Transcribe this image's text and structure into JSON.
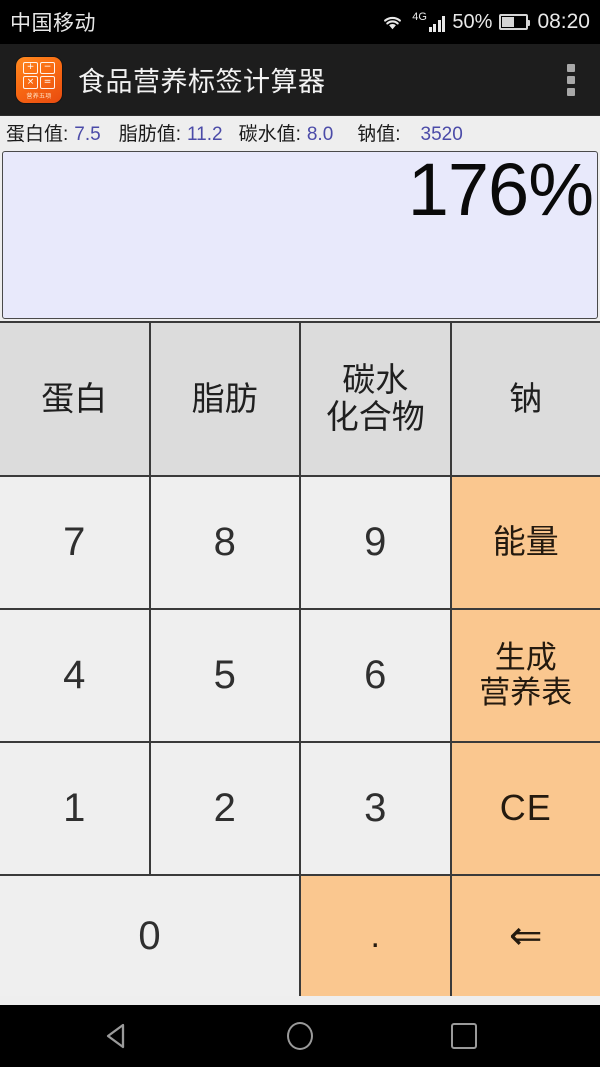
{
  "status_bar": {
    "carrier": "中国移动",
    "wifi_icon": "wifi-icon",
    "network_label": "4G",
    "signal_icon": "signal-bars-icon",
    "battery_percent": "50%",
    "battery_icon": "battery-icon",
    "clock": "08:20"
  },
  "app_bar": {
    "icon_name": "app-logo-icon",
    "icon_keys": [
      "+",
      "−",
      "×",
      "="
    ],
    "icon_brand": "营养五项",
    "title": "食品营养标签计算器",
    "overflow_icon": "overflow-menu-icon"
  },
  "values": [
    {
      "label": "蛋白值:",
      "value": "7.5"
    },
    {
      "label": "脂肪值:",
      "value": "11.2"
    },
    {
      "label": "碳水值:",
      "value": "8.0"
    },
    {
      "label": "钠值:",
      "value": "3520"
    }
  ],
  "display": {
    "value": "176%"
  },
  "keypad": {
    "nutrients": [
      {
        "label": "蛋白"
      },
      {
        "label": "脂肪"
      },
      {
        "label": "碳水\n化合物"
      },
      {
        "label": "钠"
      }
    ],
    "row2": [
      {
        "label": "7"
      },
      {
        "label": "8"
      },
      {
        "label": "9"
      },
      {
        "label": "能量"
      }
    ],
    "row3": [
      {
        "label": "4"
      },
      {
        "label": "5"
      },
      {
        "label": "6"
      },
      {
        "label": "生成\n营养表"
      }
    ],
    "row4": [
      {
        "label": "1"
      },
      {
        "label": "2"
      },
      {
        "label": "3"
      },
      {
        "label": "CE"
      }
    ],
    "row5": [
      {
        "label": "0"
      },
      {
        "label": "."
      },
      {
        "label": "⇐"
      }
    ]
  },
  "nav_bar": {
    "back_icon": "back-triangle-icon",
    "home_icon": "home-circle-icon",
    "recents_icon": "recents-square-icon"
  },
  "colors": {
    "action_key": "#fac78f",
    "digit_key": "#efefef",
    "nutrient_key": "#dcdcdc",
    "display_bg": "#e8e9fb",
    "value_number": "#4b4ba8",
    "app_bar": "#1d1d1d"
  }
}
